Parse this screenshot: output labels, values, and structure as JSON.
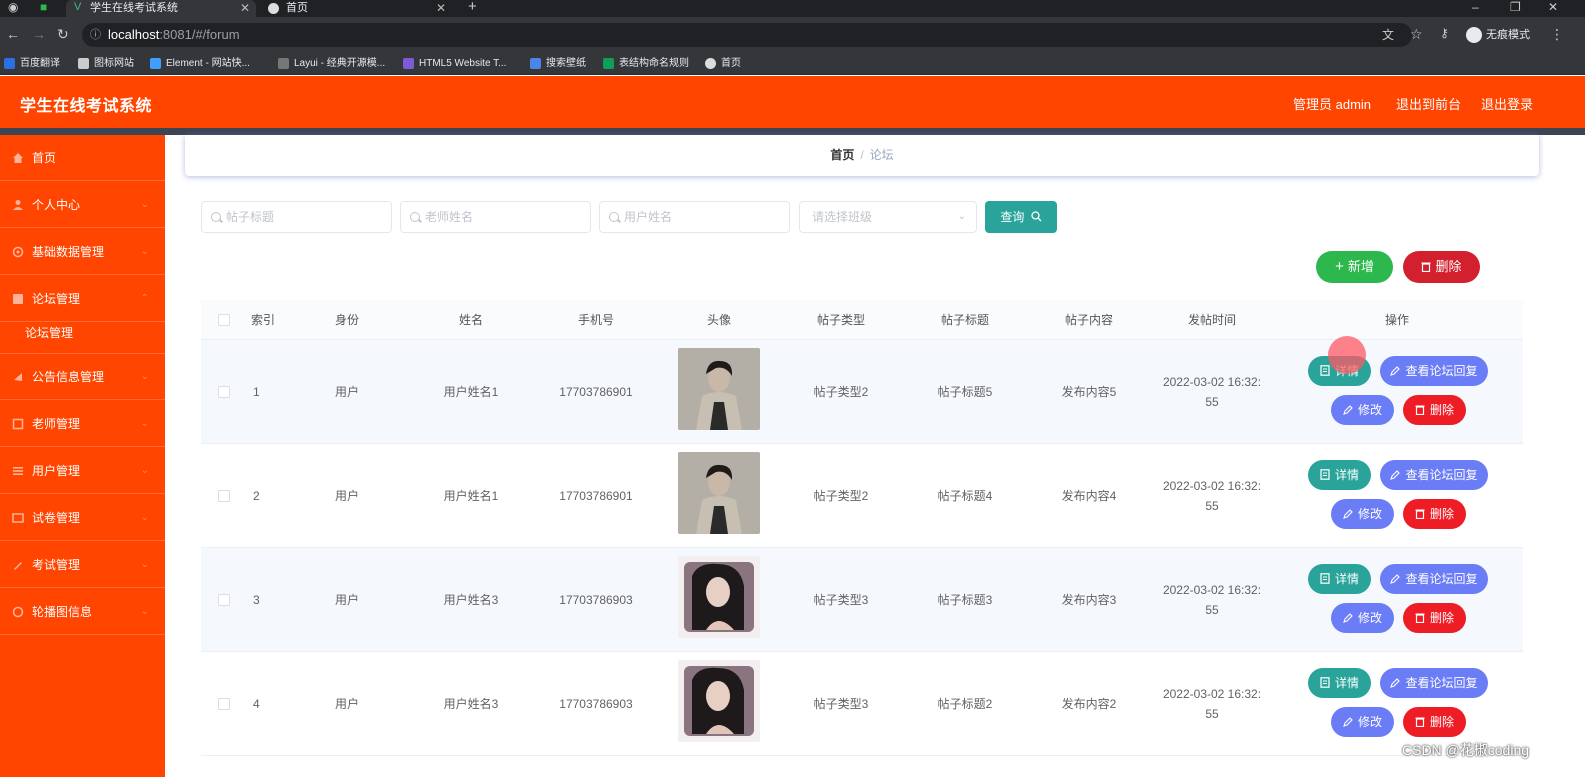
{
  "browser": {
    "tabs": [
      {
        "label": "学生在线考试系统",
        "active": true
      },
      {
        "label": "首页",
        "active": false
      }
    ],
    "new_tab_icon": "plus-icon",
    "url_host": "localhost",
    "url_path": ":8081/#/forum",
    "incognito_label": "无痕模式",
    "bookmarks": [
      "百度翻译",
      "图标网站",
      "Element - 网站快...",
      "Layui - 经典开源模...",
      "HTML5 Website T...",
      "搜索壁纸",
      "表结构命名规则",
      "首页"
    ]
  },
  "header": {
    "title": "学生在线考试系统",
    "user_label": "管理员 admin",
    "to_front_label": "退出到前台",
    "logout_label": "退出登录"
  },
  "sidebar": {
    "items": [
      {
        "label": "首页",
        "icon": "home-icon"
      },
      {
        "label": "个人中心",
        "icon": "user-icon"
      },
      {
        "label": "基础数据管理",
        "icon": "settings-icon"
      },
      {
        "label": "论坛管理",
        "icon": "forum-icon"
      },
      {
        "label": "论坛管理",
        "icon": ""
      },
      {
        "label": "公告信息管理",
        "icon": "notice-icon"
      },
      {
        "label": "老师管理",
        "icon": "teacher-icon"
      },
      {
        "label": "用户管理",
        "icon": "users-icon"
      },
      {
        "label": "试卷管理",
        "icon": "paper-icon"
      },
      {
        "label": "考试管理",
        "icon": "exam-icon"
      },
      {
        "label": "轮播图信息",
        "icon": "carousel-icon"
      }
    ]
  },
  "breadcrumb": {
    "home": "首页",
    "separator": "/",
    "current": "论坛"
  },
  "search": {
    "post_title_placeholder": "帖子标题",
    "teacher_name_placeholder": "老师姓名",
    "user_name_placeholder": "用户姓名",
    "class_placeholder": "请选择班级",
    "query_label": "查询"
  },
  "toolbar": {
    "add_label": "新增",
    "delete_label": "删除"
  },
  "table": {
    "columns": [
      "索引",
      "身份",
      "姓名",
      "手机号",
      "头像",
      "帖子类型",
      "帖子标题",
      "帖子内容",
      "发帖时间",
      "操作"
    ],
    "rows": [
      {
        "index": "1",
        "identity": "用户",
        "name": "用户姓名1",
        "phone": "17703786901",
        "avatar": "male",
        "type": "帖子类型2",
        "title": "帖子标题5",
        "content": "发布内容5",
        "time_a": "2022-03-02 16:32:",
        "time_b": "55"
      },
      {
        "index": "2",
        "identity": "用户",
        "name": "用户姓名1",
        "phone": "17703786901",
        "avatar": "male",
        "type": "帖子类型2",
        "title": "帖子标题4",
        "content": "发布内容4",
        "time_a": "2022-03-02 16:32:",
        "time_b": "55"
      },
      {
        "index": "3",
        "identity": "用户",
        "name": "用户姓名3",
        "phone": "17703786903",
        "avatar": "female",
        "type": "帖子类型3",
        "title": "帖子标题3",
        "content": "发布内容3",
        "time_a": "2022-03-02 16:32:",
        "time_b": "55"
      },
      {
        "index": "4",
        "identity": "用户",
        "name": "用户姓名3",
        "phone": "17703786903",
        "avatar": "female",
        "type": "帖子类型3",
        "title": "帖子标题2",
        "content": "发布内容2",
        "time_a": "2022-03-02 16:32:",
        "time_b": "55"
      }
    ],
    "actions": {
      "detail": "详情",
      "reply": "查看论坛回复",
      "edit": "修改",
      "delete": "删除"
    }
  },
  "colors": {
    "brand": "#ff4500",
    "teal": "#2aa39a",
    "green": "#2db84d",
    "red": "#ee1c25",
    "indigo": "#6b7cf7"
  },
  "watermark": "CSDN @花椒coding"
}
